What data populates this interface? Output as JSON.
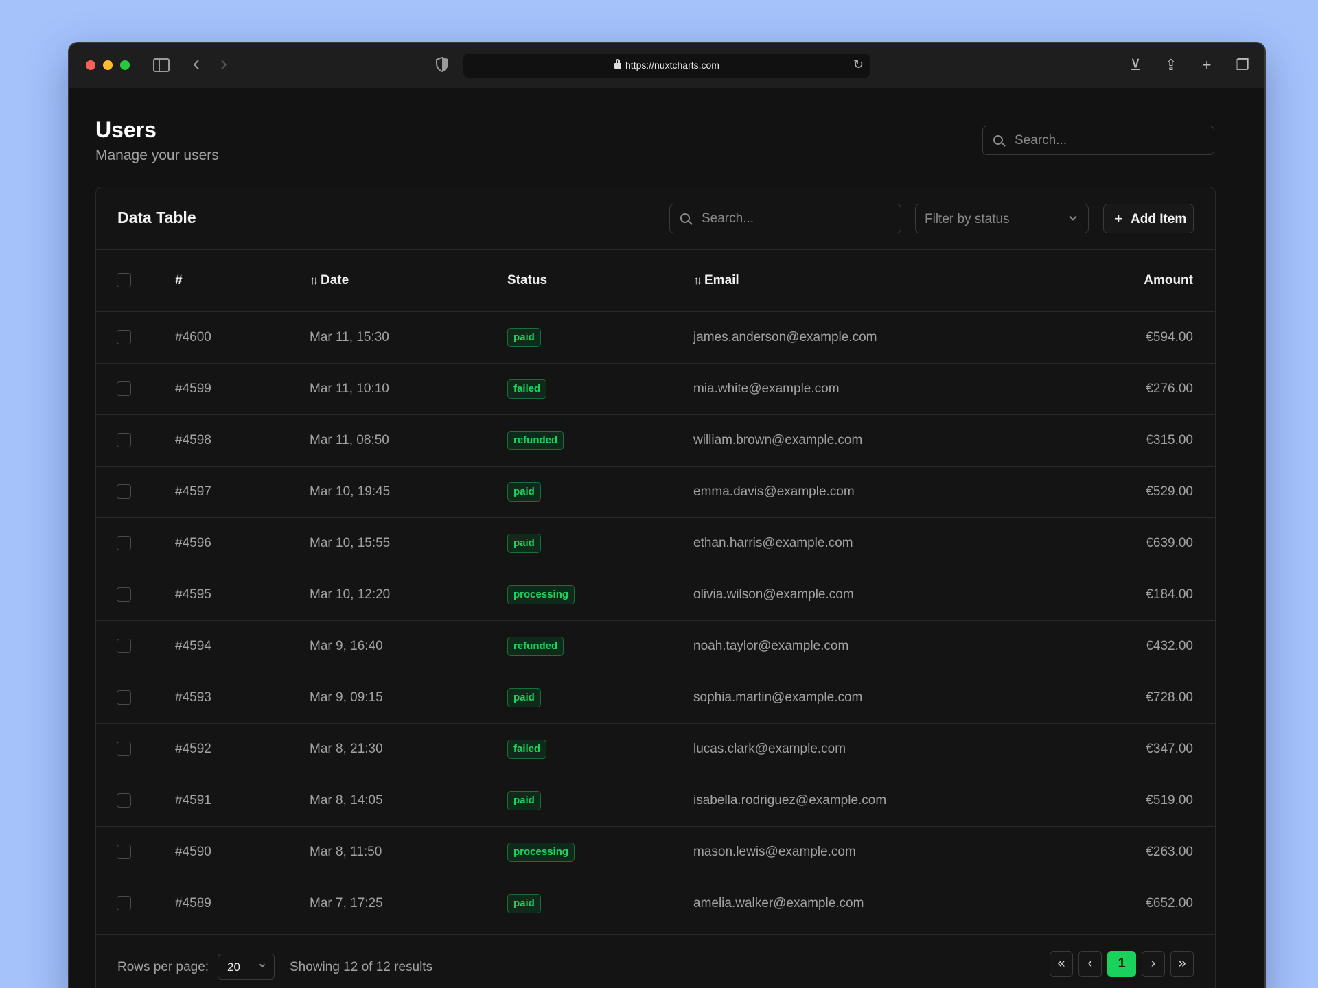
{
  "browser": {
    "url": "https://nuxtcharts.com"
  },
  "page": {
    "title": "Users",
    "subtitle": "Manage your users",
    "search_placeholder": "Search..."
  },
  "card": {
    "title": "Data Table",
    "search_placeholder": "Search...",
    "filter_placeholder": "Filter by status",
    "add_button": "Add Item"
  },
  "table": {
    "columns": {
      "id": "#",
      "date": "Date",
      "status": "Status",
      "email": "Email",
      "amount": "Amount"
    },
    "rows": [
      {
        "id": "#4600",
        "date": "Mar 11, 15:30",
        "status": "paid",
        "email": "james.anderson@example.com",
        "amount": "€594.00"
      },
      {
        "id": "#4599",
        "date": "Mar 11, 10:10",
        "status": "failed",
        "email": "mia.white@example.com",
        "amount": "€276.00"
      },
      {
        "id": "#4598",
        "date": "Mar 11, 08:50",
        "status": "refunded",
        "email": "william.brown@example.com",
        "amount": "€315.00"
      },
      {
        "id": "#4597",
        "date": "Mar 10, 19:45",
        "status": "paid",
        "email": "emma.davis@example.com",
        "amount": "€529.00"
      },
      {
        "id": "#4596",
        "date": "Mar 10, 15:55",
        "status": "paid",
        "email": "ethan.harris@example.com",
        "amount": "€639.00"
      },
      {
        "id": "#4595",
        "date": "Mar 10, 12:20",
        "status": "processing",
        "email": "olivia.wilson@example.com",
        "amount": "€184.00"
      },
      {
        "id": "#4594",
        "date": "Mar 9, 16:40",
        "status": "refunded",
        "email": "noah.taylor@example.com",
        "amount": "€432.00"
      },
      {
        "id": "#4593",
        "date": "Mar 9, 09:15",
        "status": "paid",
        "email": "sophia.martin@example.com",
        "amount": "€728.00"
      },
      {
        "id": "#4592",
        "date": "Mar 8, 21:30",
        "status": "failed",
        "email": "lucas.clark@example.com",
        "amount": "€347.00"
      },
      {
        "id": "#4591",
        "date": "Mar 8, 14:05",
        "status": "paid",
        "email": "isabella.rodriguez@example.com",
        "amount": "€519.00"
      },
      {
        "id": "#4590",
        "date": "Mar 8, 11:50",
        "status": "processing",
        "email": "mason.lewis@example.com",
        "amount": "€263.00"
      },
      {
        "id": "#4589",
        "date": "Mar 7, 17:25",
        "status": "paid",
        "email": "amelia.walker@example.com",
        "amount": "€652.00"
      }
    ]
  },
  "footer": {
    "rows_per_page_label": "Rows per page:",
    "rows_per_page_value": "20",
    "showing_text": "Showing 12 of 12 results",
    "current_page": "1"
  },
  "colors": {
    "accent": "#1ad15b",
    "badge_text": "#1ed35f",
    "background": "#a5c2fb"
  }
}
